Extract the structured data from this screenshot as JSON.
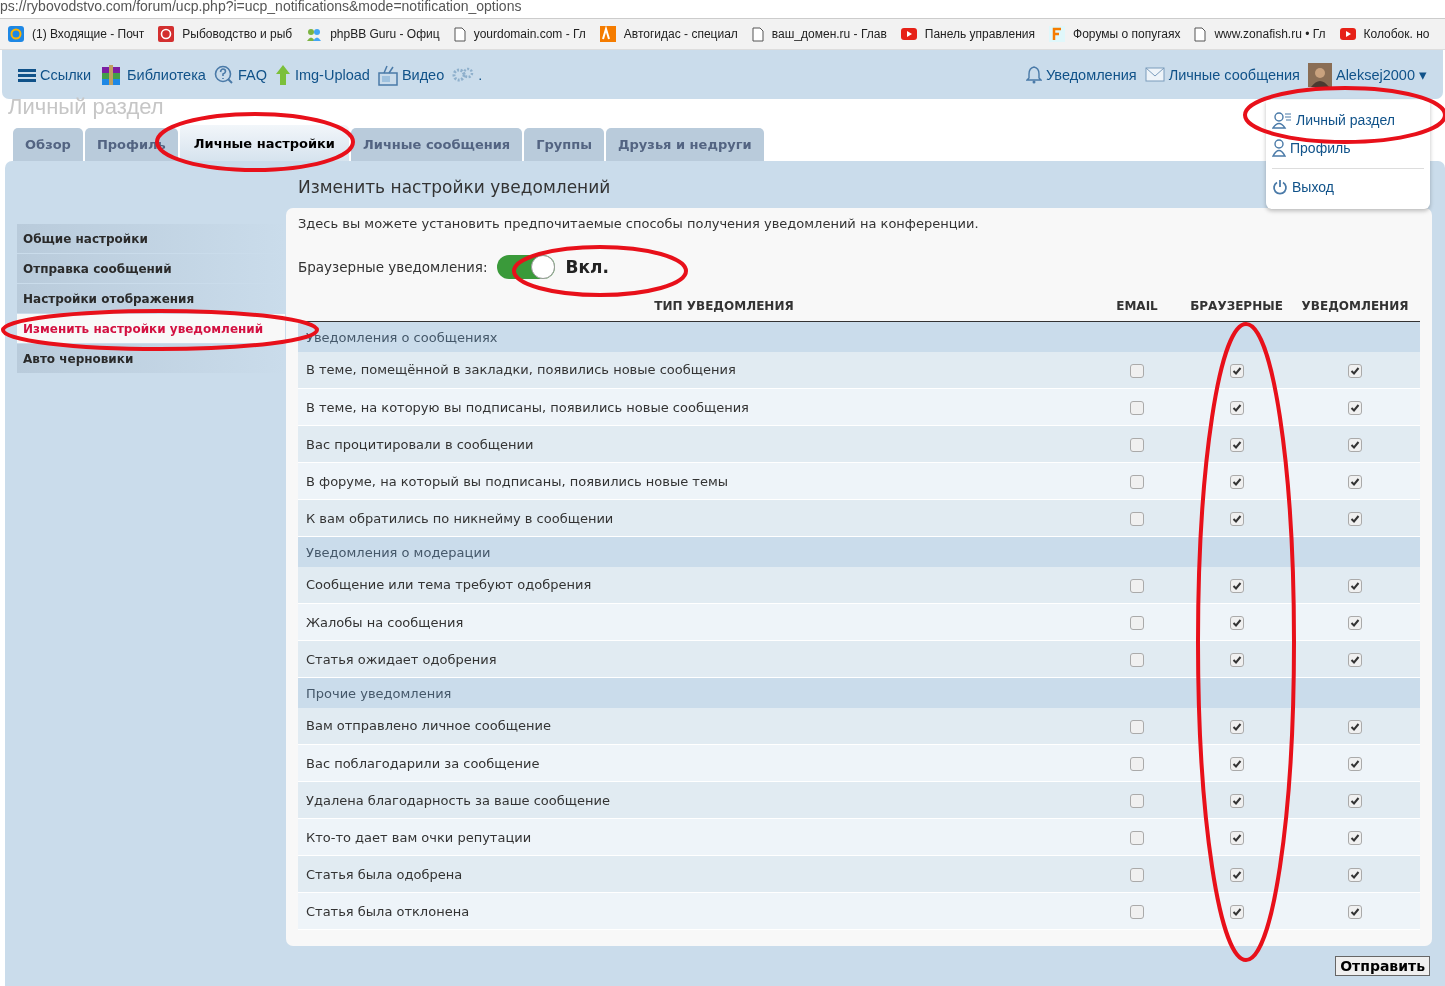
{
  "address_bar": {
    "url": "ps://rybovodstvo.com/forum/ucp.php?i=ucp_notifications&mode=notification_options"
  },
  "bookmarks": [
    {
      "kind": "mail",
      "label": "(1) Входящие - Почт"
    },
    {
      "kind": "red",
      "label": "Рыбоводство и рыб"
    },
    {
      "kind": "people",
      "label": "phpBB Guru - Офиц"
    },
    {
      "kind": "page",
      "label": "yourdomain.com - Гл"
    },
    {
      "kind": "ag",
      "label": "Автогидас - специал"
    },
    {
      "kind": "page",
      "label": "ваш_домен.ru - Глав"
    },
    {
      "kind": "video",
      "label": "Панель управления"
    },
    {
      "kind": "f",
      "label": "Форумы о попугаях"
    },
    {
      "kind": "page",
      "label": "www.zonafish.ru • Гл"
    },
    {
      "kind": "video",
      "label": "Колобок. но"
    }
  ],
  "nav": {
    "left": [
      {
        "kind": "menu",
        "label": "Ссылки"
      },
      {
        "kind": "books",
        "label": "Библиотека"
      },
      {
        "kind": "faq",
        "label": "FAQ"
      },
      {
        "kind": "upload",
        "label": "Img-Upload"
      },
      {
        "kind": "video",
        "label": "Видео"
      },
      {
        "kind": "gear",
        "label": "."
      }
    ],
    "right": [
      {
        "kind": "bell",
        "label": "Уведомления"
      },
      {
        "kind": "mail",
        "label": "Личные сообщения"
      },
      {
        "kind": "user",
        "label": "Aleksej2000 ▾"
      }
    ]
  },
  "page_title": "Личный раздел",
  "user_menu": [
    {
      "kind": "ucp",
      "label": "Личный раздел"
    },
    {
      "kind": "profile",
      "label": "Профиль"
    },
    {
      "kind": "logout",
      "label": "Выход"
    }
  ],
  "tabs": [
    {
      "label": "Обзор",
      "selected": false
    },
    {
      "label": "Профиль",
      "selected": false
    },
    {
      "label": "Личные настройки",
      "selected": true
    },
    {
      "label": "Личные сообщения",
      "selected": false
    },
    {
      "label": "Группы",
      "selected": false
    },
    {
      "label": "Друзья и недруги",
      "selected": false
    }
  ],
  "sidebar": [
    {
      "label": "Общие настройки",
      "selected": false
    },
    {
      "label": "Отправка сообщений",
      "selected": false
    },
    {
      "label": "Настройки отображения",
      "selected": false
    },
    {
      "label": "Изменить настройки уведомлений",
      "selected": true
    },
    {
      "label": "Авто черновики",
      "selected": false
    }
  ],
  "heading": "Изменить настройки уведомлений",
  "intro": "Здесь вы можете установить предпочитаемые способы получения уведомлений на конференции.",
  "browser_toggle": {
    "label": "Браузерные уведомления:",
    "on": true,
    "state_text": "Вкл."
  },
  "table": {
    "columns": [
      "ТИП УВЕДОМЛЕНИЯ",
      "EMAIL",
      "БРАУЗЕРНЫЕ",
      "УВЕДОМЛЕНИЯ"
    ],
    "rows": [
      {
        "kind": "group",
        "label": "Уведомления о сообщениях"
      },
      {
        "kind": "item",
        "label": "В теме, помещённой в закладки, появились новые сообщения",
        "email": false,
        "browser": true,
        "notification": true
      },
      {
        "kind": "item",
        "label": "В теме, на которую вы подписаны, появились новые сообщения",
        "email": false,
        "browser": true,
        "notification": true
      },
      {
        "kind": "item",
        "label": "Вас процитировали в сообщении",
        "email": false,
        "browser": true,
        "notification": true
      },
      {
        "kind": "item",
        "label": "В форуме, на который вы подписаны, появились новые темы",
        "email": false,
        "browser": true,
        "notification": true
      },
      {
        "kind": "item",
        "label": "К вам обратились по никнейму в сообщении",
        "email": false,
        "browser": true,
        "notification": true
      },
      {
        "kind": "group",
        "label": "Уведомления о модерации"
      },
      {
        "kind": "item",
        "label": "Сообщение или тема требуют одобрения",
        "email": false,
        "browser": true,
        "notification": true
      },
      {
        "kind": "item",
        "label": "Жалобы на сообщения",
        "email": false,
        "browser": true,
        "notification": true
      },
      {
        "kind": "item",
        "label": "Статья ожидает одобрения",
        "email": false,
        "browser": true,
        "notification": true
      },
      {
        "kind": "group",
        "label": "Прочие уведомления"
      },
      {
        "kind": "item",
        "label": "Вам отправлено личное сообщение",
        "email": false,
        "browser": true,
        "notification": true
      },
      {
        "kind": "item",
        "label": "Вас поблагодарили за сообщение",
        "email": false,
        "browser": true,
        "notification": true
      },
      {
        "kind": "item",
        "label": "Удалена благодарность за ваше сообщение",
        "email": false,
        "browser": true,
        "notification": true
      },
      {
        "kind": "item",
        "label": "Кто-то дает вам очки репутации",
        "email": false,
        "browser": true,
        "notification": true
      },
      {
        "kind": "item",
        "label": "Статья была одобрена",
        "email": false,
        "browser": true,
        "notification": true
      },
      {
        "kind": "item",
        "label": "Статья была отклонена",
        "email": false,
        "browser": true,
        "notification": true
      }
    ]
  },
  "submit": "Отправить"
}
